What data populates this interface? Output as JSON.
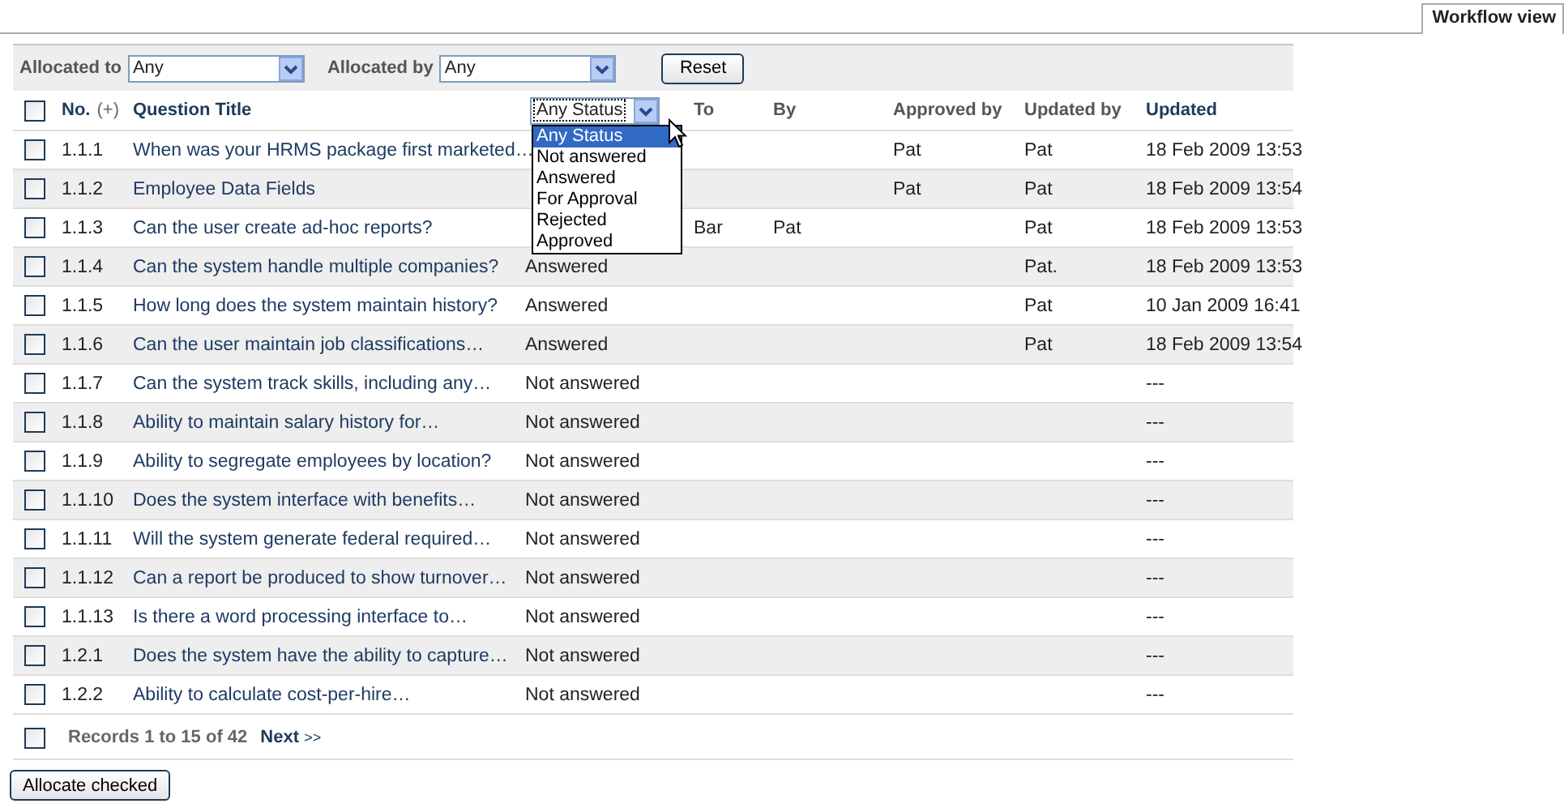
{
  "tab": {
    "label": "Workflow view",
    "selected": true
  },
  "filters": [
    {
      "label": "Allocated to",
      "value": "Any"
    },
    {
      "label": "Allocated by",
      "value": "Any"
    }
  ],
  "reset_button": "Reset",
  "header": {
    "checked": false,
    "columns": [
      {
        "label": "No.",
        "extra": "(+)",
        "kind": "link"
      },
      {
        "label": "Question Title",
        "kind": "link"
      },
      {
        "label": "Any Status",
        "kind": "select"
      },
      {
        "label": "To",
        "kind": "plain"
      },
      {
        "label": "By",
        "kind": "plain"
      },
      {
        "label": "Approved by",
        "kind": "plain"
      },
      {
        "label": "Updated by",
        "kind": "plain"
      },
      {
        "label": "Updated",
        "kind": "link"
      }
    ]
  },
  "status_menu": {
    "expanded": true,
    "options": [
      {
        "label": "Any Status",
        "selected": true
      },
      {
        "label": "Not answered",
        "selected": false
      },
      {
        "label": "Answered",
        "selected": false
      },
      {
        "label": "For Approval",
        "selected": false
      },
      {
        "label": "Rejected",
        "selected": false
      },
      {
        "label": "Approved",
        "selected": false
      }
    ]
  },
  "rows": [
    {
      "checked": false,
      "no": "1.1.1",
      "title": "When was your HRMS package first marketed…",
      "approved_by": "Pat",
      "updated_by": "Pat",
      "updated": "18 Feb 2009 13:53"
    },
    {
      "checked": false,
      "no": "1.1.2",
      "title": "Employee Data Fields",
      "approved_by": "Pat",
      "updated_by": "Pat",
      "updated": "18 Feb 2009 13:54"
    },
    {
      "checked": false,
      "no": "1.1.3",
      "title": "Can the user create ad-hoc reports?",
      "to": "Bar",
      "by": "Pat",
      "updated_by": "Pat",
      "updated": "18 Feb 2009 13:53"
    },
    {
      "checked": false,
      "no": "1.1.4",
      "title": "Can the system handle multiple companies?",
      "status": "Answered",
      "updated_by": "Pat.",
      "updated": "18 Feb 2009 13:53"
    },
    {
      "checked": false,
      "no": "1.1.5",
      "title": "How long does the system maintain history?",
      "status": "Answered",
      "updated_by": "Pat",
      "updated": "10 Jan 2009 16:41"
    },
    {
      "checked": false,
      "no": "1.1.6",
      "title": "Can the user maintain job classifications…",
      "status": "Answered",
      "updated_by": "Pat",
      "updated": "18 Feb 2009 13:54"
    },
    {
      "checked": false,
      "no": "1.1.7",
      "title": "Can the system track skills, including any…",
      "status": "Not answered",
      "updated": "---"
    },
    {
      "checked": false,
      "no": "1.1.8",
      "title": "Ability to maintain salary history for…",
      "status": "Not answered",
      "updated": "---"
    },
    {
      "checked": false,
      "no": "1.1.9",
      "title": "Ability to segregate employees by location?",
      "status": "Not answered",
      "updated": "---"
    },
    {
      "checked": false,
      "no": "1.1.10",
      "title": "Does the system interface with benefits…",
      "status": "Not answered",
      "updated": "---"
    },
    {
      "checked": false,
      "no": "1.1.11",
      "title": "Will the system generate federal required…",
      "status": "Not answered",
      "updated": "---"
    },
    {
      "checked": false,
      "no": "1.1.12",
      "title": "Can a report be produced to show turnover…",
      "status": "Not answered",
      "updated": "---"
    },
    {
      "checked": false,
      "no": "1.1.13",
      "title": "Is there a word processing interface to…",
      "status": "Not answered",
      "updated": "---"
    },
    {
      "checked": false,
      "no": "1.2.1",
      "title": "Does the system have the ability to capture…",
      "status": "Not answered",
      "updated": "---"
    },
    {
      "checked": false,
      "no": "1.2.2",
      "title": "Ability to calculate cost-per-hire…",
      "status": "Not answered",
      "updated": "---"
    }
  ],
  "footer": {
    "checked": false,
    "records": "Records 1 to 15 of 42",
    "next": "Next",
    "next_arrows": ">>"
  },
  "allocate_button": "Allocate checked"
}
